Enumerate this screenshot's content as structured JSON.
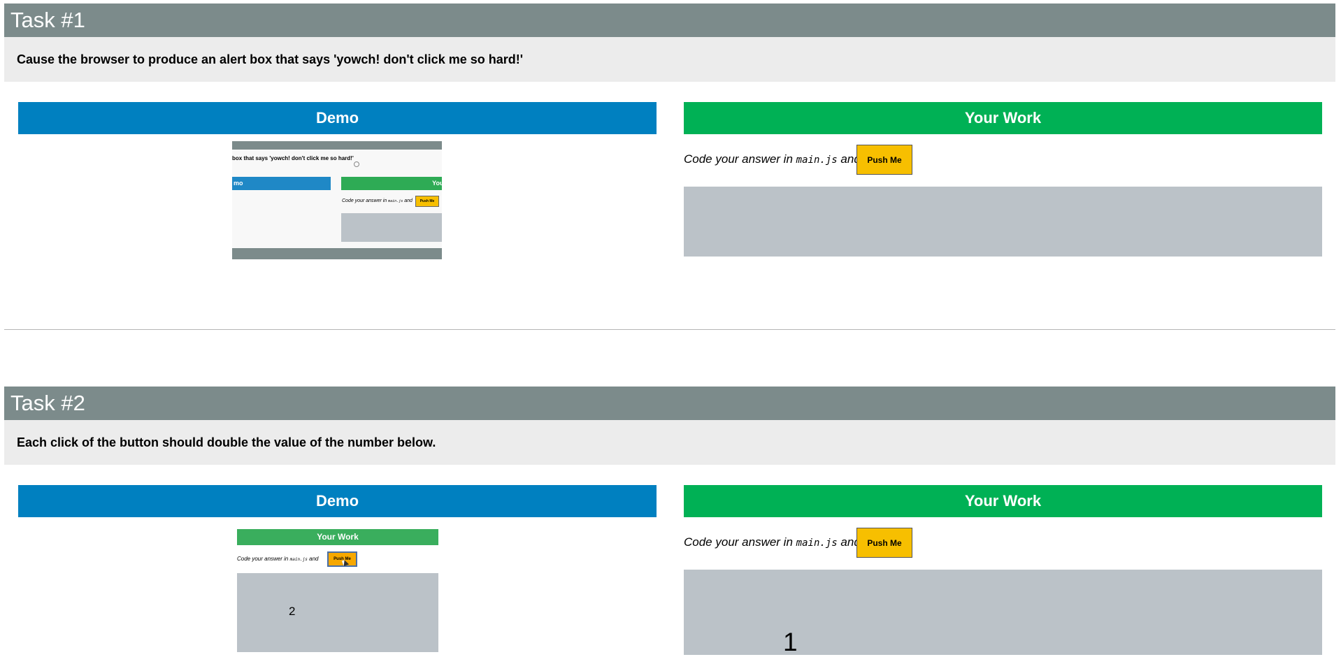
{
  "tasks": [
    {
      "title": "Task #1",
      "description": "Cause the browser to produce an alert box that says 'yowch! don't click me so hard!'",
      "demo_label": "Demo",
      "work_label": "Your Work",
      "instr_prefix": "Code your answer in",
      "instr_file": "main.js",
      "instr_suffix": "and",
      "button_label": "Push Me",
      "output_value": "",
      "demo_preview": {
        "desc": "box that says 'yowch! don't click me so hard!'",
        "demo_label": "mo",
        "work_label": "Your",
        "instr_prefix": "Code your answer in",
        "instr_file": "main.js",
        "instr_suffix": "and",
        "button_label": "Push Me"
      }
    },
    {
      "title": "Task #2",
      "description": "Each click of the button should double the value of the number below.",
      "demo_label": "Demo",
      "work_label": "Your Work",
      "instr_prefix": "Code your answer in",
      "instr_file": "main.js",
      "instr_suffix": "and",
      "button_label": "Push Me",
      "output_value": "1",
      "demo_preview": {
        "work_label": "Your Work",
        "instr_prefix": "Code your answer in",
        "instr_file": "main.js",
        "instr_suffix": "and",
        "button_label": "Push Me",
        "output_value": "2"
      }
    }
  ],
  "colors": {
    "task_header": "#7c8b8b",
    "description_bg": "#ececec",
    "demo_header": "#0080c0",
    "work_header": "#00b155",
    "button": "#f7bf00",
    "output_bg": "#bbc2c8"
  }
}
